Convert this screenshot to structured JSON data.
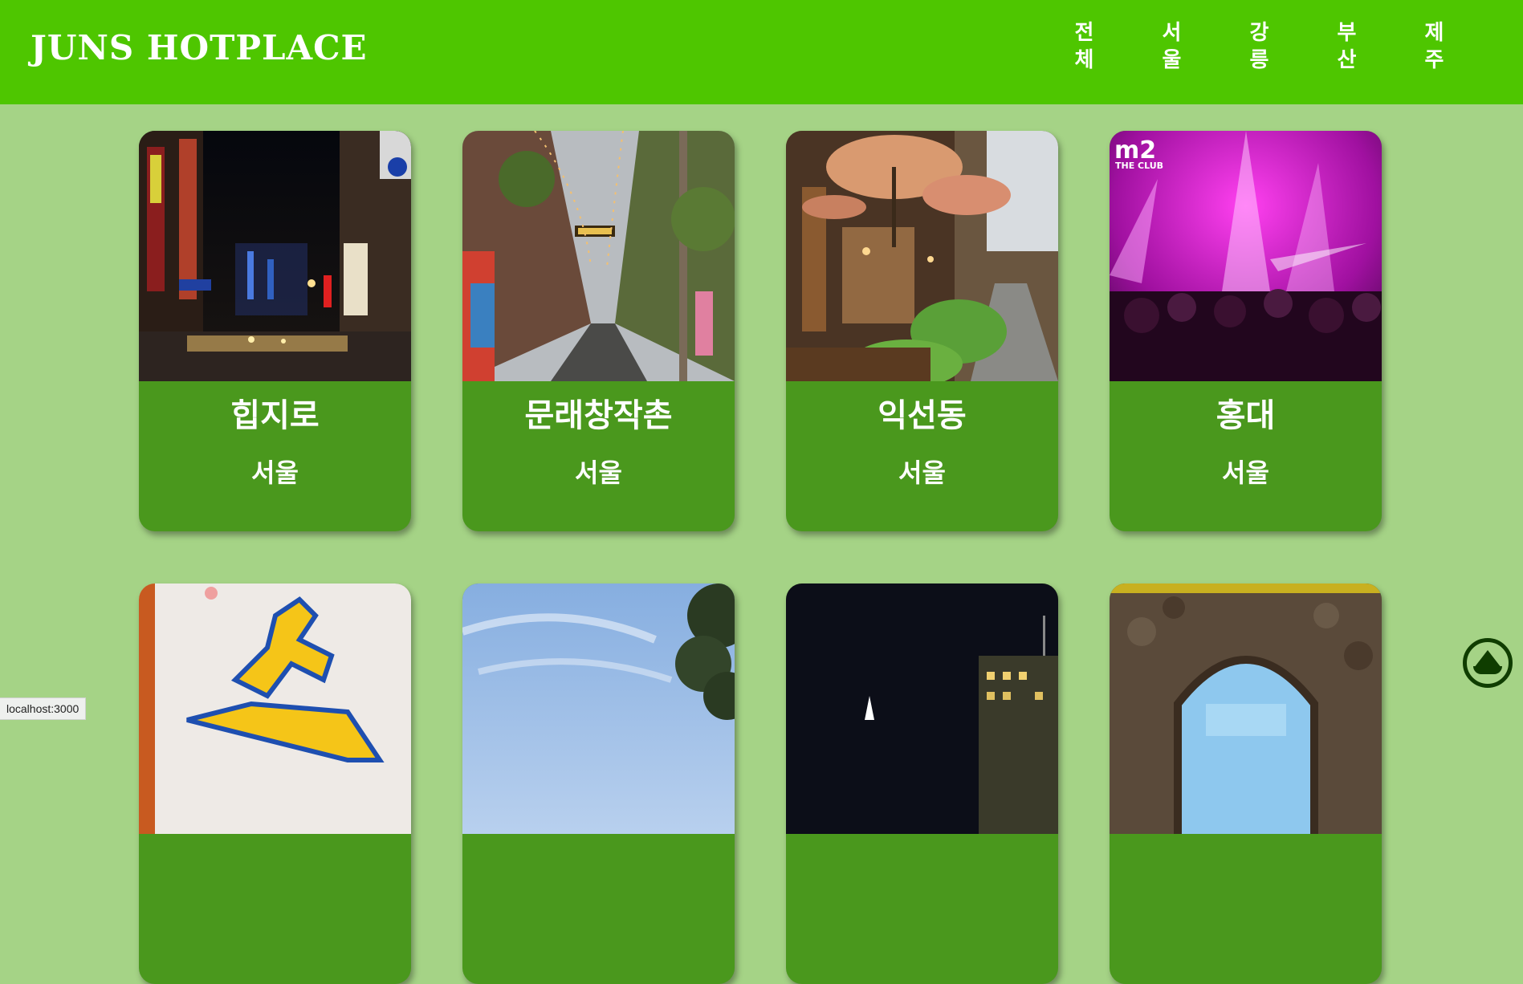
{
  "header": {
    "logo": "JUNS HOTPLACE",
    "nav": [
      {
        "line1": "전",
        "line2": "체"
      },
      {
        "line1": "서",
        "line2": "울"
      },
      {
        "line1": "강",
        "line2": "릉"
      },
      {
        "line1": "부",
        "line2": "산"
      },
      {
        "line1": "제",
        "line2": "주"
      }
    ]
  },
  "cards": [
    {
      "title": "힙지로",
      "region": "서울"
    },
    {
      "title": "문래창작촌",
      "region": "서울"
    },
    {
      "title": "익선동",
      "region": "서울"
    },
    {
      "title": "홍대",
      "region": "서울"
    },
    {
      "title": "",
      "region": ""
    },
    {
      "title": "",
      "region": ""
    },
    {
      "title": "",
      "region": ""
    },
    {
      "title": "",
      "region": ""
    }
  ],
  "photo_texts": {
    "club_logo": "m2",
    "club_sub": "THE CLUB"
  },
  "status_bar": "localhost:3000",
  "colors": {
    "header_bg": "#4ec600",
    "page_bg": "#a5d386",
    "card_bg": "#4a981d"
  }
}
